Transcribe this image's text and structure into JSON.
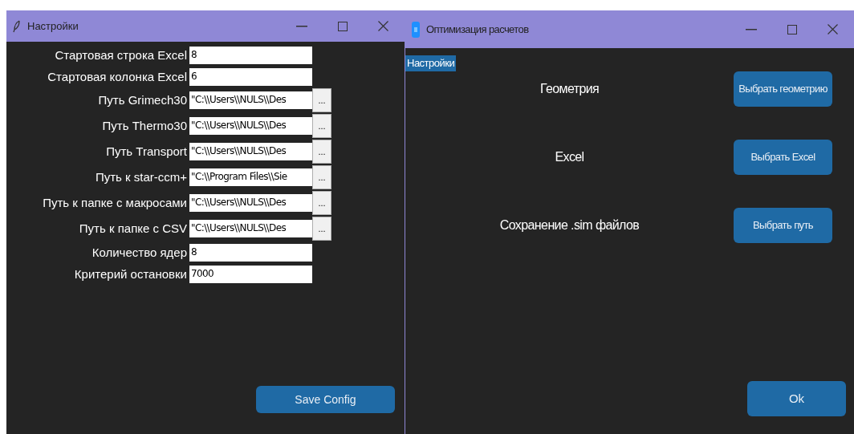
{
  "settings_window": {
    "title": "Настройки",
    "fields": [
      {
        "kind": "entry",
        "label": "Стартовая строка Excel",
        "value": "8"
      },
      {
        "kind": "entry",
        "label": "Стартовая колонка Excel",
        "value": "6"
      },
      {
        "kind": "path",
        "label": "Путь Grimech30",
        "value": "\"C:\\\\Users\\\\NULS\\\\Des",
        "browse": "..."
      },
      {
        "kind": "path",
        "label": "Путь Thermo30",
        "value": "\"C:\\\\Users\\\\NULS\\\\Des",
        "browse": "..."
      },
      {
        "kind": "path",
        "label": "Путь Transport",
        "value": "\"C:\\\\Users\\\\NULS\\\\Des",
        "browse": "..."
      },
      {
        "kind": "path",
        "label": "Путь к star-ccm+",
        "value": "\"C:\\\\Program Files\\\\Sie",
        "browse": "..."
      },
      {
        "kind": "path",
        "label": "Путь к папке с макросами",
        "value": "\"C:\\\\Users\\\\NULS\\\\Des",
        "browse": "..."
      },
      {
        "kind": "path",
        "label": "Путь к папке с CSV",
        "value": "\"C:\\\\Users\\\\NULS\\\\Des",
        "browse": "..."
      },
      {
        "kind": "entry",
        "label": "Количество ядер",
        "value": "8"
      },
      {
        "kind": "entry",
        "label": "Критерий остановки",
        "value": "7000"
      }
    ],
    "save_button": "Save Config"
  },
  "main_window": {
    "title": "Оптимизация расчетов",
    "menu": [
      {
        "label": "Настройки",
        "selected": true
      }
    ],
    "rows": [
      {
        "label": "Геометрия",
        "button": "Выбрать геометрию"
      },
      {
        "label": "Excel",
        "button": "Выбрать Excel"
      },
      {
        "label": "Сохранение .sim файлов",
        "button": "Выбрать путь"
      }
    ],
    "ok_button": "Ok"
  }
}
